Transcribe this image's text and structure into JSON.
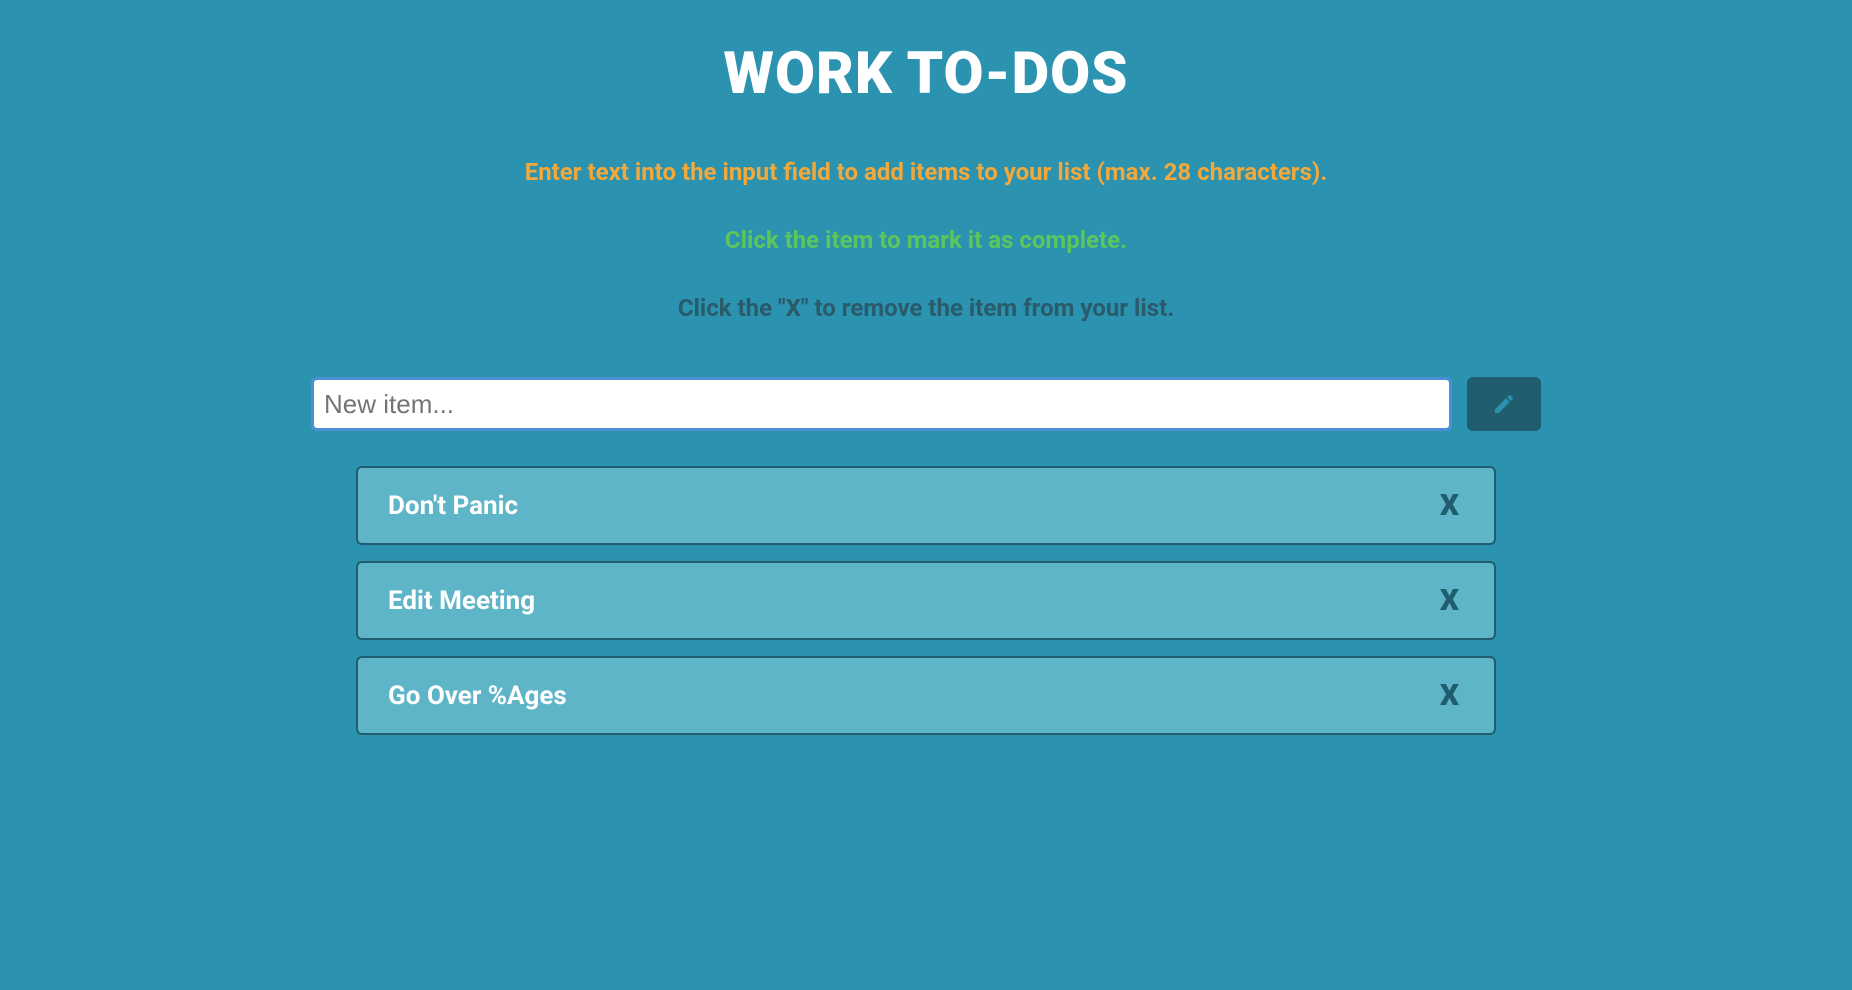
{
  "header": {
    "title": "WORK TO-DOS"
  },
  "instructions": {
    "line1": "Enter text into the input field to add items to your list (max. 28 characters).",
    "line2": "Click the item to mark it as complete.",
    "line3": "Click the \"X\" to remove the item from your list."
  },
  "input": {
    "placeholder": "New item...",
    "value": ""
  },
  "items": [
    {
      "text": "Don't Panic",
      "removeLabel": "X"
    },
    {
      "text": "Edit Meeting",
      "removeLabel": "X"
    },
    {
      "text": "Go Over %Ages",
      "removeLabel": "X"
    }
  ]
}
